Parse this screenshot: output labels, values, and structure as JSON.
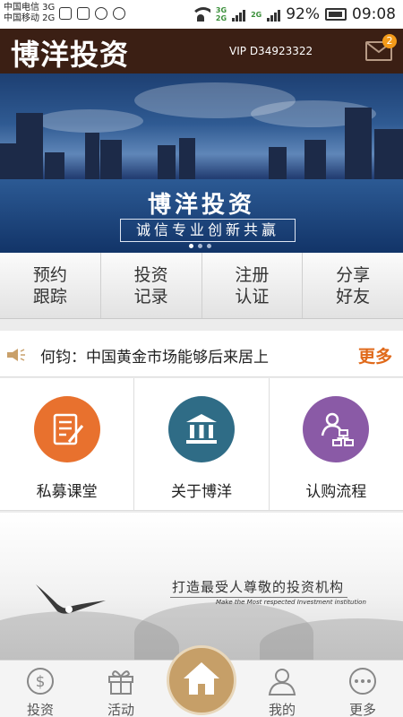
{
  "status_bar": {
    "carrier1": "中国电信 3G",
    "carrier2": "中国移动 2G",
    "net_top": "3G",
    "net_bottom": "2G",
    "net_top2": "2G",
    "battery": "92%",
    "time": "09:08"
  },
  "header": {
    "logo": "博洋投资",
    "vip_label": "VIP",
    "vip_id": "D34923322",
    "mail_badge": "2"
  },
  "banner": {
    "title": "博洋投资",
    "subtitle": "诚信专业创新共赢",
    "dots": 3,
    "active_dot": 0
  },
  "quick_buttons": [
    {
      "label": "预约\n跟踪"
    },
    {
      "label": "投资\n记录"
    },
    {
      "label": "注册\n认证"
    },
    {
      "label": "分享\n好友"
    }
  ],
  "news": {
    "headline": "何钧：中国黄金市场能够后来居上",
    "more": "更多"
  },
  "grid": [
    {
      "label": "私募课堂",
      "icon": "note-icon",
      "color": "#e8712e"
    },
    {
      "label": "关于博洋",
      "icon": "bank-icon",
      "color": "#2f6c86"
    },
    {
      "label": "认购流程",
      "icon": "org-chart-icon",
      "color": "#8a5aa6"
    }
  ],
  "promo": {
    "slogan": "打造最受人尊敬的投资机构",
    "slogan_en": "Make the Most respected Investment institution"
  },
  "bottom_nav": [
    {
      "label": "投资",
      "icon": "dollar-icon"
    },
    {
      "label": "活动",
      "icon": "gift-icon"
    },
    {
      "label": "",
      "icon": "home-icon"
    },
    {
      "label": "我的",
      "icon": "user-icon"
    },
    {
      "label": "更多",
      "icon": "more-icon"
    }
  ],
  "colors": {
    "header_bg": "#3b1f14",
    "accent_orange": "#e06a1b",
    "home_button": "#c69f68"
  }
}
